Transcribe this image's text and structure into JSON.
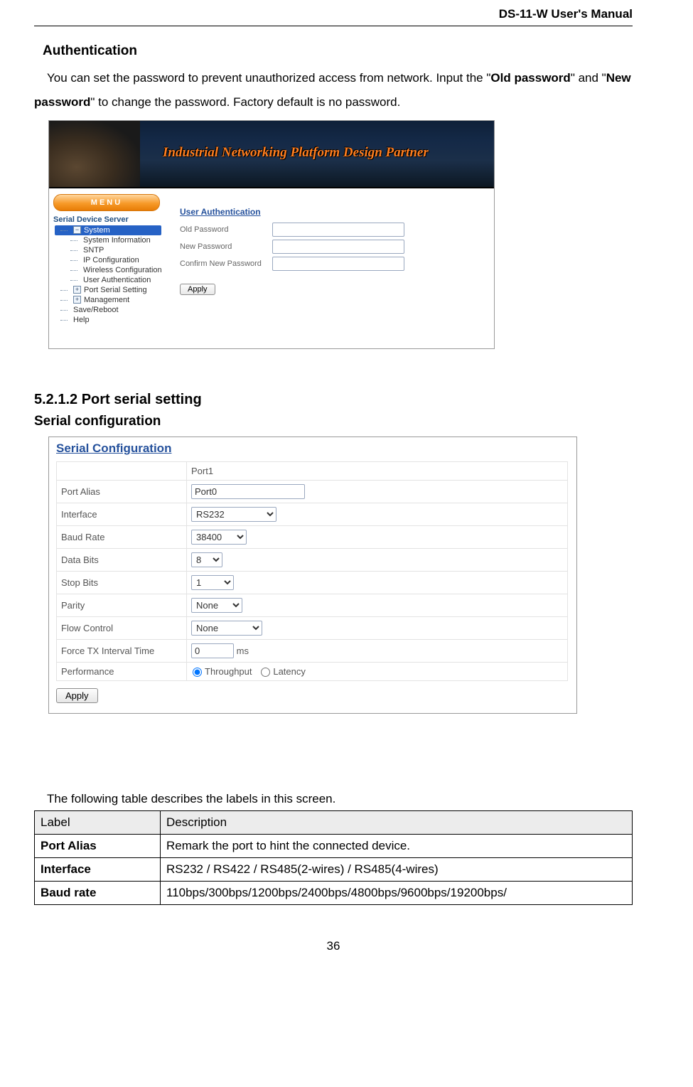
{
  "running_head": "DS-11-W User's Manual",
  "auth_heading": "Authentication",
  "auth_para_pre": "You can set the password to prevent unauthorized access from network.    Input the \"",
  "auth_bold1": "Old password",
  "auth_mid": "\" and \"",
  "auth_bold2": "New password",
  "auth_end": "\" to change the password.    Factory default is no password.",
  "shot1": {
    "banner_text": "Industrial  Networking Platform Design Partner",
    "menu_label": "MENU",
    "tree_root": "Serial Device Server",
    "tree": {
      "system": "System",
      "sys_info": "System Information",
      "sntp": "SNTP",
      "ip_cfg": "IP Configuration",
      "wireless_cfg": "Wireless Configuration",
      "user_auth": "User Authentication",
      "port_serial": "Port Serial Setting",
      "mgmt": "Management",
      "save_reboot": "Save/Reboot",
      "help": "Help"
    },
    "section_title": "User Authentication",
    "old_pw": "Old Password",
    "new_pw": "New Password",
    "confirm_pw": "Confirm New Password",
    "apply": "Apply"
  },
  "section_num": "5.2.1.2    Port serial setting",
  "section_sub": "Serial configuration",
  "shot2": {
    "title": "Serial Configuration",
    "port_col_header": "Port1",
    "rows": {
      "port_alias_lbl": "Port Alias",
      "port_alias_val": "Port0",
      "interface_lbl": "Interface",
      "interface_val": "RS232",
      "baud_lbl": "Baud Rate",
      "baud_val": "38400",
      "databits_lbl": "Data Bits",
      "databits_val": "8",
      "stopbits_lbl": "Stop Bits",
      "stopbits_val": "1",
      "parity_lbl": "Parity",
      "parity_val": "None",
      "flow_lbl": "Flow Control",
      "flow_val": "None",
      "force_lbl": "Force TX Interval Time",
      "force_val": "0",
      "force_unit": "ms",
      "perf_lbl": "Performance",
      "perf_throughput": "Throughput",
      "perf_latency": "Latency"
    },
    "apply": "Apply"
  },
  "desc_intro": "The following table describes the labels in this screen.",
  "param_table": {
    "head_label": "Label",
    "head_desc": "Description",
    "rows": [
      {
        "label": "Port Alias",
        "desc": "Remark the port to hint the connected device."
      },
      {
        "label": "Interface",
        "desc": "RS232 / RS422 / RS485(2-wires) / RS485(4-wires)"
      },
      {
        "label": "Baud rate",
        "desc": "110bps/300bps/1200bps/2400bps/4800bps/9600bps/19200bps/"
      }
    ]
  },
  "page_number": "36"
}
